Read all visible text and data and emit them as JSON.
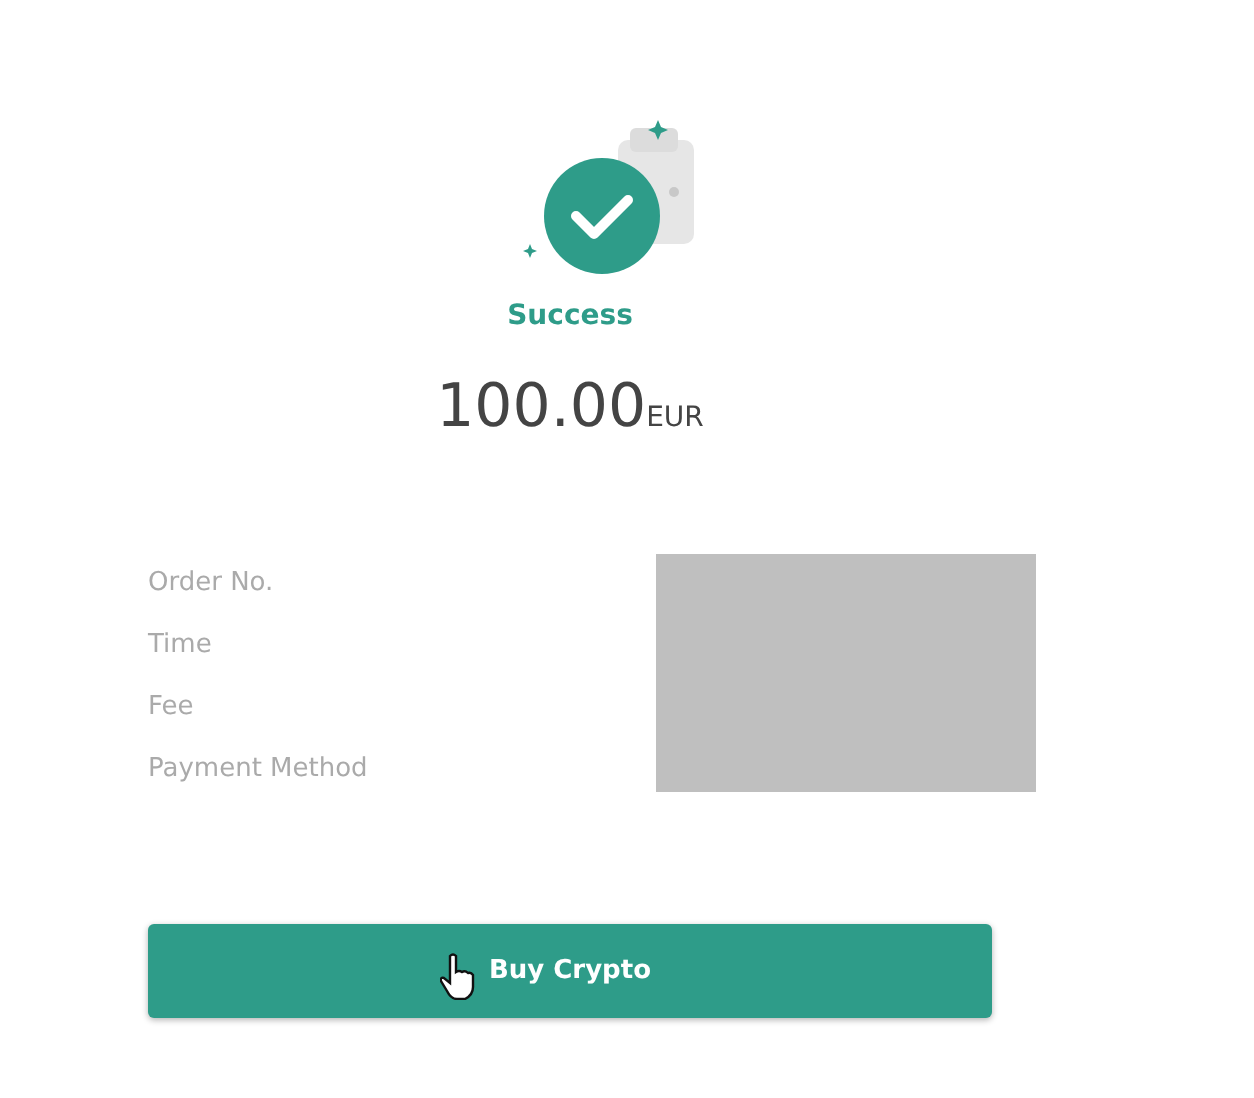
{
  "status": {
    "label": "Success"
  },
  "amount": {
    "value": "100.00",
    "currency": "EUR"
  },
  "details": [
    {
      "label": "Order No."
    },
    {
      "label": "Time"
    },
    {
      "label": "Fee"
    },
    {
      "label": "Payment Method"
    }
  ],
  "button": {
    "label": "Buy Crypto"
  }
}
